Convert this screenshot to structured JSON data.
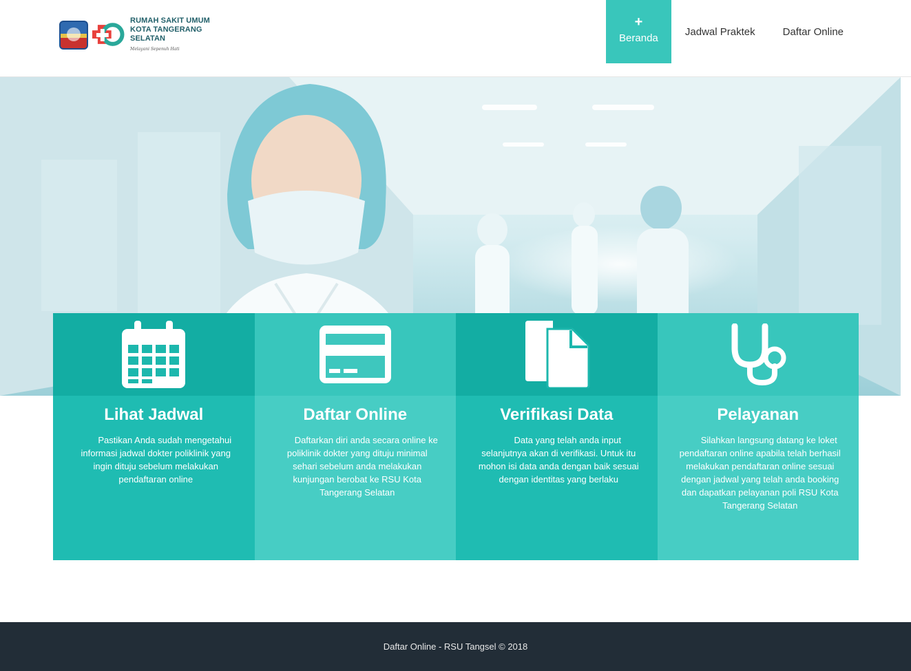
{
  "header": {
    "logo": {
      "line1": "RUMAH SAKIT UMUM",
      "line2": "KOTA TANGERANG SELATAN",
      "tagline": "Melayani Sepenuh Hati"
    },
    "nav": [
      {
        "label": "Beranda",
        "active": true,
        "icon": "plus-icon"
      },
      {
        "label": "Jadwal Praktek",
        "active": false
      },
      {
        "label": "Daftar Online",
        "active": false
      }
    ],
    "accent_color": "#39c6bb"
  },
  "features": [
    {
      "title": "Lihat Jadwal",
      "icon": "calendar-icon",
      "text": "Pastikan Anda sudah mengetahui informasi jadwal dokter poliklinik yang ingin dituju sebelum melakukan pendaftaran online"
    },
    {
      "title": "Daftar Online",
      "icon": "credit-card-icon",
      "text": "Daftarkan diri anda secara online ke poliklinik dokter yang dituju minimal sehari sebelum anda melakukan kunjungan berobat ke RSU Kota Tangerang Selatan"
    },
    {
      "title": "Verifikasi Data",
      "icon": "documents-icon",
      "text": "Data yang telah anda input selanjutnya akan di verifikasi. Untuk itu mohon isi data anda dengan baik sesuai dengan identitas yang berlaku"
    },
    {
      "title": "Pelayanan",
      "icon": "stethoscope-icon",
      "text": "Silahkan langsung datang ke loket pendaftaran online apabila telah berhasil melakukan pendaftaran online sesuai dengan jadwal yang telah anda booking dan dapatkan pelayanan poli RSU Kota Tangerang Selatan"
    }
  ],
  "footer": {
    "text": "Daftar Online - RSU Tangsel © 2018"
  }
}
